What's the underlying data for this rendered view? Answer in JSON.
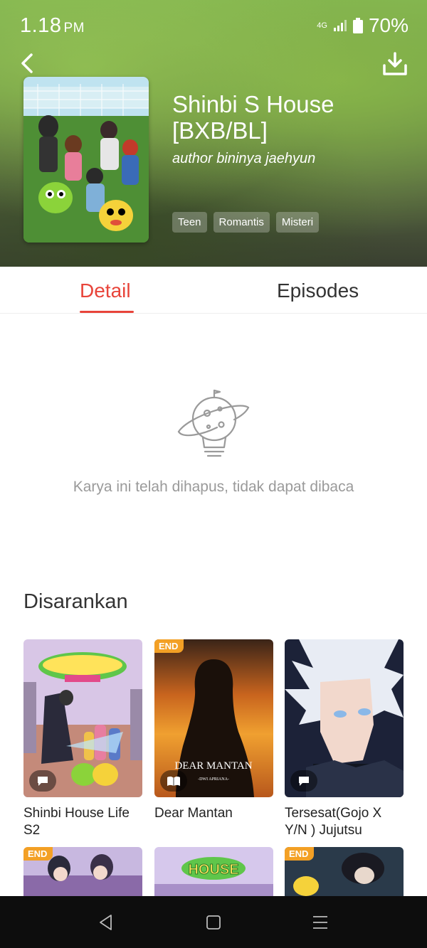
{
  "status_bar": {
    "time": "1.18",
    "period": "PM",
    "network": "4G",
    "battery": "70%"
  },
  "header": {
    "title": "Shinbi S House [BXB/BL]",
    "author": "author bininya jaehyun",
    "tags": [
      "Teen",
      "Romantis",
      "Misteri"
    ]
  },
  "tabs": {
    "detail": "Detail",
    "episodes": "Episodes"
  },
  "empty_state": {
    "message": "Karya ini telah dihapus, tidak dapat dibaca"
  },
  "recommended": {
    "title": "Disarankan",
    "items": [
      {
        "title": "Shinbi House Life S2",
        "badge": "",
        "type_icon": "chat-icon"
      },
      {
        "title": "Dear Mantan",
        "badge": "END",
        "type_icon": "book-icon",
        "cover_text": "DEAR MANTAN",
        "cover_sub": "-DWI APRIANA-"
      },
      {
        "title": "Tersesat(Gojo X Y/N ) Jujutsu",
        "badge": "",
        "type_icon": "chat-icon"
      },
      {
        "title": "",
        "badge": "END"
      },
      {
        "title": "",
        "badge": "",
        "cover_text": "HOUSE"
      },
      {
        "title": "",
        "badge": "END"
      }
    ]
  },
  "colors": {
    "accent": "#e8443a",
    "end_badge": "#f3a025"
  }
}
